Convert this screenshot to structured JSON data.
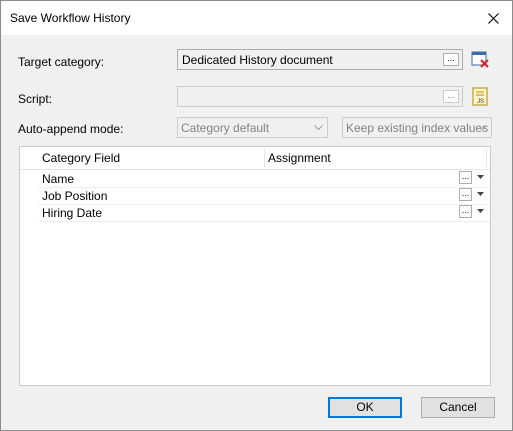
{
  "window": {
    "title": "Save Workflow History"
  },
  "form": {
    "target_category_label": "Target category:",
    "target_category_value": "Dedicated History document",
    "script_label": "Script:",
    "script_value": "",
    "auto_append_label": "Auto-append mode:",
    "auto_append_value": "Category default",
    "index_mode_value": "Keep existing index values",
    "browse_label": "..."
  },
  "grid": {
    "columns": [
      "Category Field",
      "Assignment"
    ],
    "rows": [
      {
        "field": "Name",
        "assignment": ""
      },
      {
        "field": "Job Position",
        "assignment": ""
      },
      {
        "field": "Hiring Date",
        "assignment": ""
      }
    ]
  },
  "buttons": {
    "ok": "OK",
    "cancel": "Cancel"
  },
  "icons": {
    "close": "close-icon",
    "clear_category": "category-clear-icon",
    "js_script": "js-script-icon",
    "dropdown": "chevron-down-icon"
  }
}
